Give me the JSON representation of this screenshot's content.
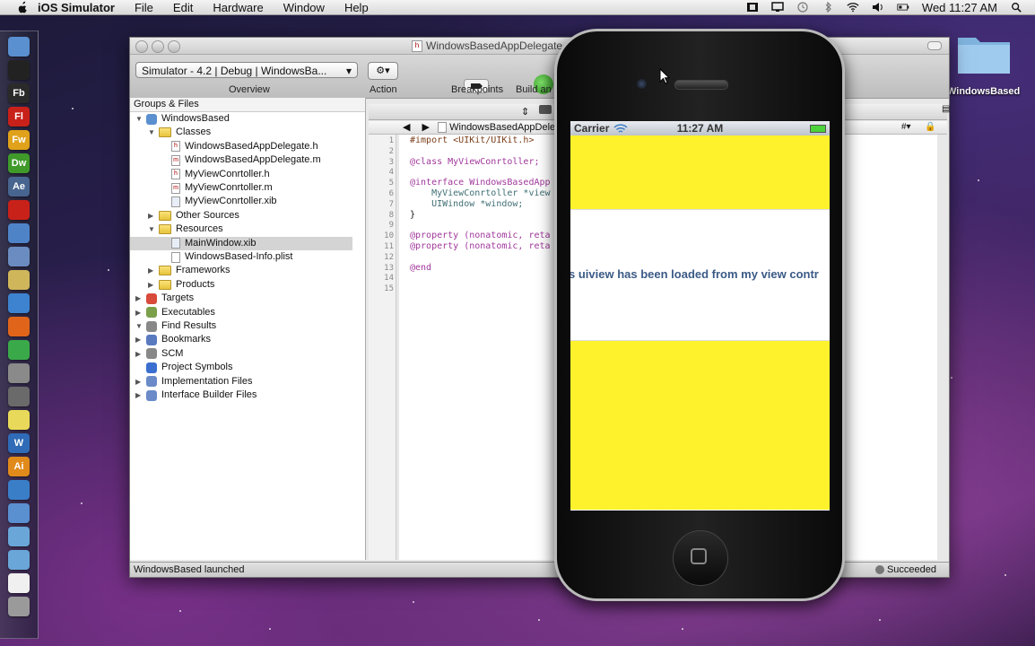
{
  "menubar": {
    "app_name": "iOS Simulator",
    "menus": [
      "File",
      "Edit",
      "Hardware",
      "Window",
      "Help"
    ],
    "clock": "Wed 11:27 AM"
  },
  "dock": {
    "items": [
      {
        "label": "",
        "icon": "finder-icon",
        "color": "#5a8fd0"
      },
      {
        "label": "",
        "icon": "terminal-icon",
        "color": "#222222"
      },
      {
        "label": "Fb",
        "icon": "flash-builder-icon",
        "color": "#2a2a2a"
      },
      {
        "label": "Fl",
        "icon": "flash-icon",
        "color": "#c8211a"
      },
      {
        "label": "Fw",
        "icon": "fireworks-icon",
        "color": "#e0a11b"
      },
      {
        "label": "Dw",
        "icon": "dreamweaver-icon",
        "color": "#3f9a2a"
      },
      {
        "label": "Ae",
        "icon": "after-effects-icon",
        "color": "#47658f"
      },
      {
        "label": "",
        "icon": "acrobat-icon",
        "color": "#c8211a"
      },
      {
        "label": "",
        "icon": "xcode-icon",
        "color": "#4f83c8"
      },
      {
        "label": "",
        "icon": "interface-builder-icon",
        "color": "#6b8cc0"
      },
      {
        "label": "",
        "icon": "instruments-icon",
        "color": "#cfb65a"
      },
      {
        "label": "",
        "icon": "safari-icon",
        "color": "#3d83cf"
      },
      {
        "label": "",
        "icon": "firefox-icon",
        "color": "#e0651b"
      },
      {
        "label": "",
        "icon": "chrome-icon",
        "color": "#3aa94a"
      },
      {
        "label": "",
        "icon": "system-preferences-icon",
        "color": "#8a8a8a"
      },
      {
        "label": "",
        "icon": "camera-icon",
        "color": "#6a6a6a"
      },
      {
        "label": "",
        "icon": "stickies-icon",
        "color": "#e8d95a"
      },
      {
        "label": "W",
        "icon": "word-icon",
        "color": "#2f6bb6"
      },
      {
        "label": "Ai",
        "icon": "illustrator-icon",
        "color": "#e08a1b"
      },
      {
        "label": "",
        "icon": "itunes-icon",
        "color": "#3a7ec8"
      },
      {
        "label": "",
        "icon": "preview-icon",
        "color": "#5a8fd0"
      },
      {
        "label": "",
        "icon": "folder-icon",
        "color": "#6aa6d8"
      },
      {
        "label": "",
        "icon": "downloads-folder-icon",
        "color": "#6aa6d8"
      },
      {
        "label": "",
        "icon": "document-icon",
        "color": "#f0f0f0"
      },
      {
        "label": "",
        "icon": "trash-icon",
        "color": "#9a9a9a"
      }
    ]
  },
  "xcode": {
    "title": "WindowsBasedAppDelegate",
    "scheme_popup": "Simulator - 4.2 | Debug | WindowsBa...",
    "toolbar_labels": {
      "overview": "Overview",
      "action": "Action",
      "breakpoints": "Breakpoints",
      "build": "Build an"
    },
    "sidebar_header": "Groups & Files",
    "tree": [
      {
        "label": "WindowsBased",
        "kind": "project",
        "tri": "▼",
        "level": 0
      },
      {
        "label": "Classes",
        "kind": "folder",
        "tri": "▼",
        "level": 1
      },
      {
        "label": "WindowsBasedAppDelegate.h",
        "kind": "h",
        "tri": "",
        "level": 2
      },
      {
        "label": "WindowsBasedAppDelegate.m",
        "kind": "m",
        "tri": "",
        "level": 2
      },
      {
        "label": "MyViewConrtoller.h",
        "kind": "h",
        "tri": "",
        "level": 2
      },
      {
        "label": "MyViewConrtoller.m",
        "kind": "m",
        "tri": "",
        "level": 2
      },
      {
        "label": "MyViewConrtoller.xib",
        "kind": "xib",
        "tri": "",
        "level": 2
      },
      {
        "label": "Other Sources",
        "kind": "folder",
        "tri": "▶",
        "level": 1
      },
      {
        "label": "Resources",
        "kind": "folder",
        "tri": "▼",
        "level": 1
      },
      {
        "label": "MainWindow.xib",
        "kind": "xib",
        "tri": "",
        "level": 2
      },
      {
        "label": "WindowsBased-Info.plist",
        "kind": "plist",
        "tri": "",
        "level": 2
      },
      {
        "label": "Frameworks",
        "kind": "folder",
        "tri": "▶",
        "level": 1
      },
      {
        "label": "Products",
        "kind": "folder",
        "tri": "▶",
        "level": 1
      },
      {
        "label": "Targets",
        "kind": "target",
        "tri": "▶",
        "level": 0
      },
      {
        "label": "Executables",
        "kind": "exec",
        "tri": "▶",
        "level": 0
      },
      {
        "label": "Find Results",
        "kind": "find",
        "tri": "▼",
        "level": 0
      },
      {
        "label": "Bookmarks",
        "kind": "bookmarks",
        "tri": "▶",
        "level": 0
      },
      {
        "label": "SCM",
        "kind": "scm",
        "tri": "▶",
        "level": 0
      },
      {
        "label": "Project Symbols",
        "kind": "symbols",
        "tri": "",
        "level": 0
      },
      {
        "label": "Implementation Files",
        "kind": "impl",
        "tri": "▶",
        "level": 0
      },
      {
        "label": "Interface Builder Files",
        "kind": "ib",
        "tri": "▶",
        "level": 0
      }
    ],
    "selected_item": "MainWindow.xib",
    "nav_file": "WindowsBasedAppDelegate",
    "code_lines": [
      "#import <UIKit/UIKit.h>",
      "",
      "@class MyViewConrtoller;",
      "",
      "@interface WindowsBasedApp",
      "    MyViewConrtoller *view",
      "    UIWindow *window;",
      "}",
      "",
      "@property (nonatomic, reta",
      "@property (nonatomic, reta",
      "",
      "@end",
      "",
      ""
    ],
    "line_numbers": [
      "1",
      "2",
      "3",
      "4",
      "5",
      "6",
      "7",
      "8",
      "9",
      "10",
      "11",
      "12",
      "13",
      "14",
      "15"
    ],
    "status_left": "WindowsBased launched",
    "status_right": "Succeeded"
  },
  "desktop": {
    "folder_label": "WindowsBased"
  },
  "iphone": {
    "carrier": "Carrier",
    "time": "11:27 AM",
    "message": "s uiview has been loaded from my view contr",
    "yellow_color": "#fdf22c"
  }
}
